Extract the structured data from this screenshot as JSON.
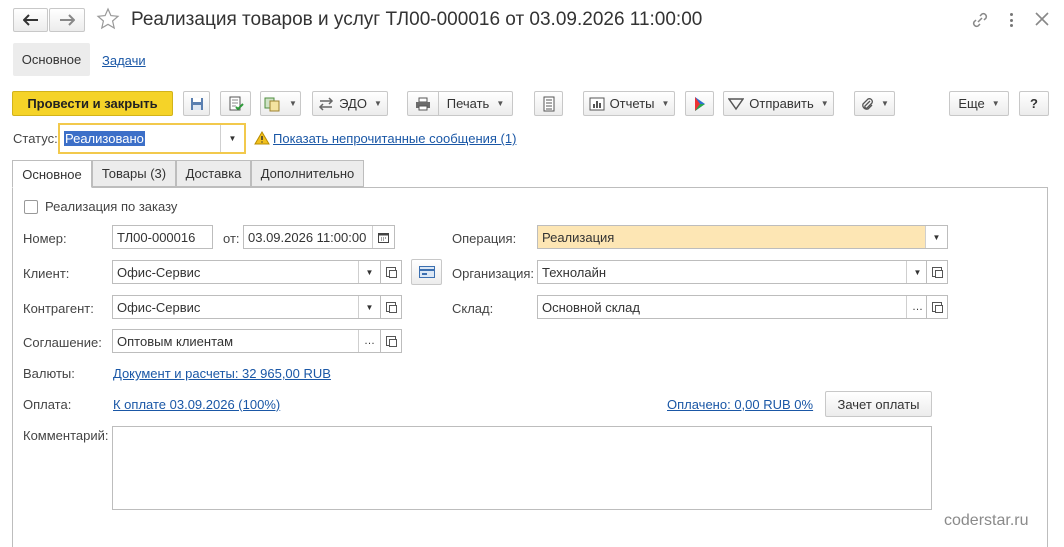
{
  "title": "Реализация товаров и услуг ТЛ00-000016 от 03.09.2026 11:00:00",
  "nav_tabs": {
    "main": "Основное",
    "tasks": "Задачи"
  },
  "toolbar": {
    "post_close": "Провести и закрыть",
    "edo": "ЭДО",
    "print": "Печать",
    "reports": "Отчеты",
    "send": "Отправить",
    "more": "Еще",
    "help": "?"
  },
  "status": {
    "label": "Статус:",
    "value": "Реализовано",
    "messages_link": "Показать непрочитанные сообщения (1)"
  },
  "tabs": [
    "Основное",
    "Товары (3)",
    "Доставка",
    "Дополнительно"
  ],
  "form": {
    "by_order_label": "Реализация по заказу",
    "number_label": "Номер:",
    "number_value": "ТЛ00-000016",
    "from_label": "от:",
    "date_value": "03.09.2026 11:00:00",
    "operation_label": "Операция:",
    "operation_value": "Реализация",
    "client_label": "Клиент:",
    "client_value": "Офис-Сервис",
    "org_label": "Организация:",
    "org_value": "Технолайн",
    "contractor_label": "Контрагент:",
    "contractor_value": "Офис-Сервис",
    "warehouse_label": "Склад:",
    "warehouse_value": "Основной склад",
    "agreement_label": "Соглашение:",
    "agreement_value": "Оптовым клиентам",
    "currency_label": "Валюты:",
    "currency_link": "Документ и расчеты: 32 965,00 RUB",
    "payment_label": "Оплата:",
    "payment_link": "К оплате 03.09.2026 (100%)",
    "paid_link": "Оплачено: 0,00 RUB 0%",
    "offset_button": "Зачет оплаты",
    "comment_label": "Комментарий:"
  },
  "watermark": "coderstar.ru",
  "colors": {
    "accent": "#f5d328",
    "operation_bg": "#fde6b4",
    "link": "#1a57a6",
    "status_focus": "#f2c94c"
  }
}
